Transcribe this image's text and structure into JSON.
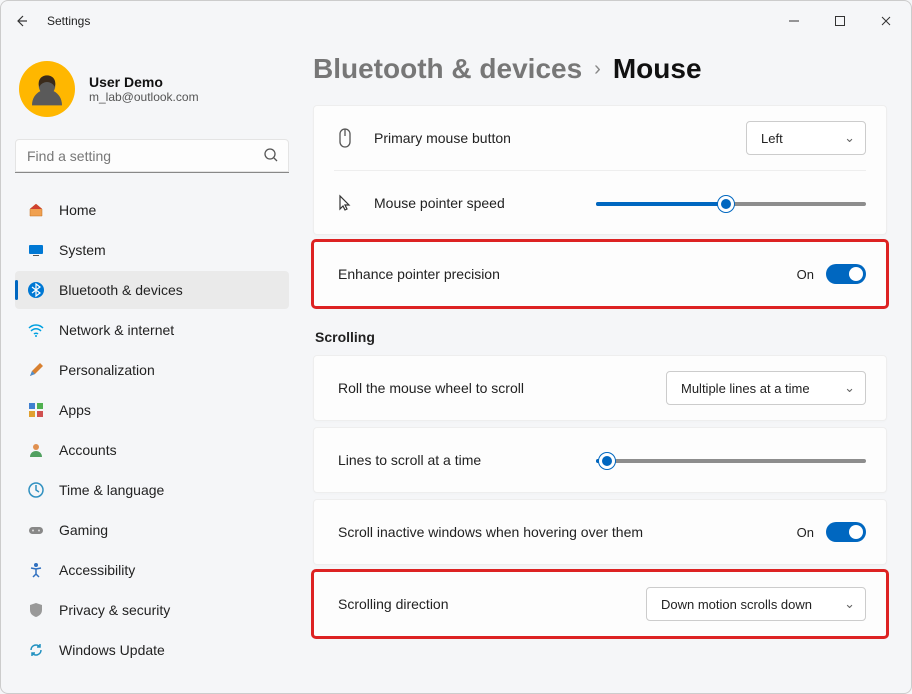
{
  "app": {
    "title": "Settings"
  },
  "user": {
    "name": "User Demo",
    "email": "m_lab@outlook.com"
  },
  "search": {
    "placeholder": "Find a setting"
  },
  "nav": {
    "items": [
      {
        "label": "Home"
      },
      {
        "label": "System"
      },
      {
        "label": "Bluetooth & devices"
      },
      {
        "label": "Network & internet"
      },
      {
        "label": "Personalization"
      },
      {
        "label": "Apps"
      },
      {
        "label": "Accounts"
      },
      {
        "label": "Time & language"
      },
      {
        "label": "Gaming"
      },
      {
        "label": "Accessibility"
      },
      {
        "label": "Privacy & security"
      },
      {
        "label": "Windows Update"
      }
    ],
    "active_index": 2
  },
  "breadcrumb": {
    "parent": "Bluetooth & devices",
    "current": "Mouse"
  },
  "mouse": {
    "primary_button": {
      "label": "Primary mouse button",
      "value": "Left"
    },
    "pointer_speed": {
      "label": "Mouse pointer speed",
      "percent": 48
    },
    "enhance_precision": {
      "label": "Enhance pointer precision",
      "state_text": "On",
      "on": true
    }
  },
  "scrolling": {
    "section_title": "Scrolling",
    "wheel_mode": {
      "label": "Roll the mouse wheel to scroll",
      "value": "Multiple lines at a time"
    },
    "lines_at_a_time": {
      "label": "Lines to scroll at a time",
      "percent": 4
    },
    "inactive_windows": {
      "label": "Scroll inactive windows when hovering over them",
      "state_text": "On",
      "on": true
    },
    "direction": {
      "label": "Scrolling direction",
      "value": "Down motion scrolls down"
    }
  }
}
